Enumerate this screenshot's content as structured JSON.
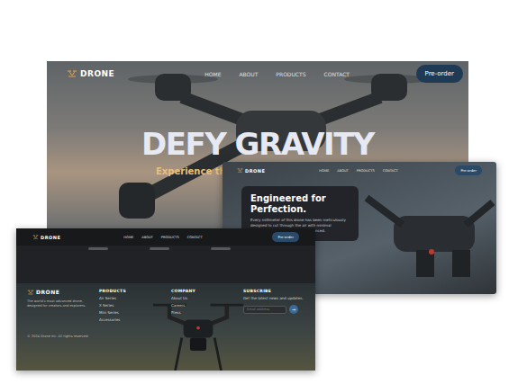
{
  "nav": {
    "logo": "DRONE",
    "links": [
      "HOME",
      "ABOUT",
      "PRODUCTS",
      "CONTACT"
    ],
    "cta": "Pre-order"
  },
  "hero": {
    "title": "DEFY GRAVITY",
    "subtitle": "Experience the ne"
  },
  "feature": {
    "title": "Engineered for Perfection.",
    "body": "Every millimeter of this drone has been meticulously designed to cut through the air with minimal resistance. Built with the most advanced."
  },
  "footer": {
    "brand": "DRONE",
    "tagline": "The world's most advanced drone, designed for creators and explorers.",
    "columns": [
      {
        "title": "PRODUCTS",
        "items": [
          "Air Series",
          "X Series",
          "Mini Series",
          "Accessories"
        ]
      },
      {
        "title": "COMPANY",
        "items": [
          "About Us",
          "Careers",
          "Press"
        ]
      }
    ],
    "subscribe": {
      "title": "SUBSCRIBE",
      "text": "Get the latest news and updates.",
      "placeholder": "Email address",
      "button": "→"
    },
    "copyright": "© 2024 Drone Inc. All rights reserved."
  }
}
